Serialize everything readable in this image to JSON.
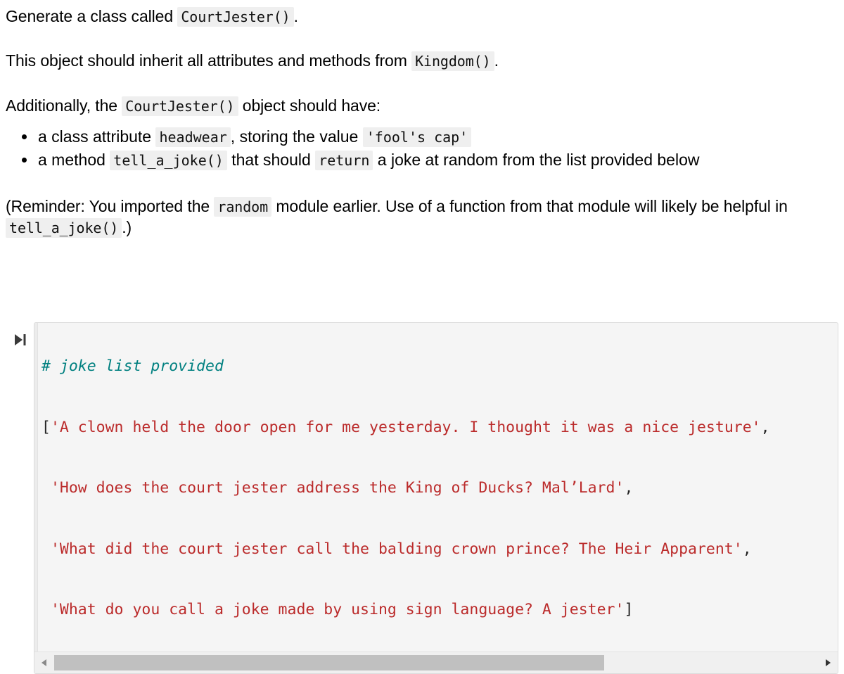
{
  "prose": {
    "p1": {
      "before": "Generate a class called ",
      "code": "CourtJester()",
      "after": "."
    },
    "p2": {
      "before": "This object should inherit all attributes and methods from ",
      "code": "Kingdom()",
      "after": "."
    },
    "p3": {
      "before": "Additionally, the ",
      "code": "CourtJester()",
      "after": " object should have:"
    },
    "bullets": [
      {
        "seg1": "a class attribute ",
        "code1": "headwear",
        "seg2": ", storing the value ",
        "code2": "'fool's cap'",
        "seg3": ""
      },
      {
        "seg1": "a method ",
        "code1": "tell_a_joke()",
        "seg2": " that should ",
        "code2": "return",
        "seg3": " a joke at random from the list provided below"
      }
    ],
    "p4": {
      "before": "(Reminder: You imported the ",
      "code1": "random",
      "middle": " module earlier. Use of a function from that module will likely be helpful in ",
      "code2": "tell_a_joke()",
      "after": ".)"
    }
  },
  "code_cell": {
    "run_button_label": "run-cell",
    "run_icon": "play-to-end-icon",
    "lines": [
      {
        "type": "comment",
        "text": "# joke list provided"
      },
      {
        "type": "list_open",
        "bracket": "[",
        "string": "'A clown held the door open for me yesterday. I thought it was a nice jesture'",
        "trailing": ","
      },
      {
        "type": "list_item",
        "indent": " ",
        "string": "'How does the court jester address the King of Ducks? Mal’Lard'",
        "trailing": ","
      },
      {
        "type": "list_item",
        "indent": " ",
        "string": "'What did the court jester call the balding crown prince? The Heir Apparent'",
        "trailing": ","
      },
      {
        "type": "list_close",
        "indent": " ",
        "string": "'What do you call a joke made by using sign language? A jester'",
        "trailing": "]"
      }
    ],
    "scrollbar": {
      "left_arrow": "scroll-left-arrow",
      "right_arrow": "scroll-right-arrow",
      "thumb_position_percent": 0,
      "thumb_width_percent": 72
    }
  },
  "colors": {
    "comment": "#008080",
    "string": "#bb2b2b",
    "punctuation": "#242424",
    "inline_code_bg": "#efefef",
    "cell_bg": "#f5f5f5",
    "cell_border": "#dcdcdc",
    "scrollbar_thumb": "#c0c0c0"
  }
}
